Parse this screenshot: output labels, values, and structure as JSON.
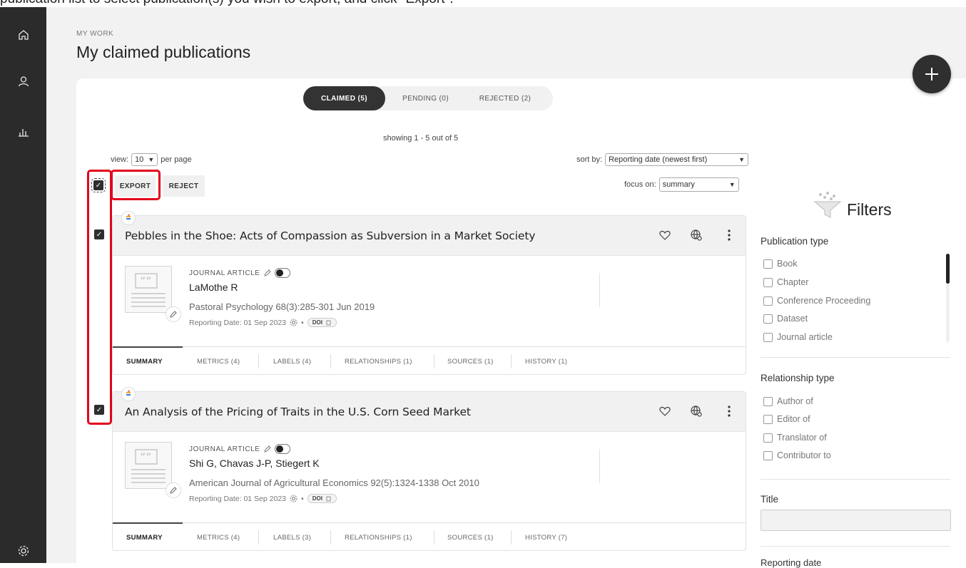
{
  "instruction": "publication list to select publication(s) you wish to export, and click \"Export\".",
  "header": {
    "eyebrow": "MY WORK",
    "title": "My claimed publications"
  },
  "tabs": [
    {
      "label": "CLAIMED (5)",
      "active": true
    },
    {
      "label": "PENDING (0)",
      "active": false
    },
    {
      "label": "REJECTED (2)",
      "active": false
    }
  ],
  "list": {
    "showing": "showing 1 - 5 out of 5",
    "view_label": "view:",
    "view_value": "10",
    "per_page": "per page",
    "sort_label": "sort by:",
    "sort_value": "Reporting date (newest first)",
    "focus_label": "focus on:",
    "focus_value": "summary",
    "export_label": "EXPORT",
    "reject_label": "REJECT"
  },
  "publications": [
    {
      "title": "Pebbles in the Shoe: Acts of Compassion as Subversion in a Market Society",
      "type": "JOURNAL ARTICLE",
      "authors": "LaMothe R",
      "journal": "Pastoral Psychology 68(3):285-301 Jun 2019",
      "reporting": "Reporting Date: 01 Sep 2023",
      "doi": "DOI",
      "tabs": [
        "SUMMARY",
        "METRICS (4)",
        "LABELS (4)",
        "RELATIONSHIPS (1)",
        "SOURCES (1)",
        "HISTORY (1)"
      ]
    },
    {
      "title": "An Analysis of the Pricing of Traits in the U.S. Corn Seed Market",
      "type": "JOURNAL ARTICLE",
      "authors": "Shi G, Chavas J-P, Stiegert K",
      "journal": "American Journal of Agricultural Economics 92(5):1324-1338 Oct 2010",
      "reporting": "Reporting Date: 01 Sep 2023",
      "doi": "DOI",
      "tabs": [
        "SUMMARY",
        "METRICS (4)",
        "LABELS (3)",
        "RELATIONSHIPS (1)",
        "SOURCES (1)",
        "HISTORY (7)"
      ]
    }
  ],
  "filters": {
    "title": "Filters",
    "publication_type": {
      "title": "Publication type",
      "options": [
        "Book",
        "Chapter",
        "Conference Proceeding",
        "Dataset",
        "Journal article"
      ]
    },
    "relationship_type": {
      "title": "Relationship type",
      "options": [
        "Author of",
        "Editor of",
        "Translator of",
        "Contributor to"
      ]
    },
    "title_filter": {
      "title": "Title"
    },
    "cut_label": "Reporting date"
  },
  "colors": {
    "accent_dark": "#2f2f2f",
    "highlight": "#e3001b",
    "sidebar": "#2b2b2b"
  }
}
